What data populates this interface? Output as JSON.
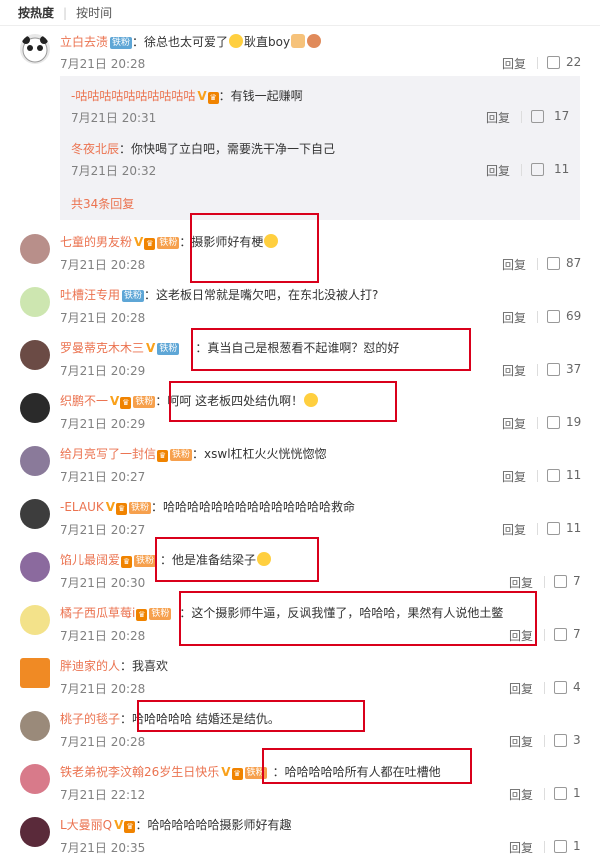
{
  "sort": {
    "hot": "按热度",
    "time": "按时间"
  },
  "reply_label": "回复",
  "more_replies": "共34条回复",
  "comments": [
    {
      "name": "立白去渍",
      "badge": "铁粉",
      "text": "：徐总也太可爱了",
      "text2": "耿直boy",
      "time": "7月21日 20:28",
      "likes": "22"
    },
    {
      "name": "七童的男友粉",
      "badge": "铁粉",
      "text": "：摄影师好有梗",
      "time": "7月21日 20:28",
      "likes": "87"
    },
    {
      "name": "吐槽汪专用",
      "badge": "铁粉",
      "text": "：这老板日常就是嘴欠吧，在东北没被人打?",
      "time": "7月21日 20:28",
      "likes": "69"
    },
    {
      "name": "罗曼蒂克木木三",
      "badge": "铁粉",
      "text": "：真当自己是根葱看不起谁啊？怼的好",
      "time": "7月21日 20:29",
      "likes": "37"
    },
    {
      "name": "织鹏不一",
      "badge": "铁粉",
      "text": "：呵呵 这老板四处结仇啊！",
      "time": "7月21日 20:29",
      "likes": "19"
    },
    {
      "name": "给月亮写了一封信",
      "badge": "铁粉",
      "text": "：xswl杠杠火火恍恍惚惚",
      "time": "7月21日 20:27",
      "likes": "11"
    },
    {
      "name": "-ELAUK",
      "badge": "铁粉",
      "text": "：哈哈哈哈哈哈哈哈哈哈哈哈哈哈救命",
      "time": "7月21日 20:27",
      "likes": "11"
    },
    {
      "name": "馅儿最阔爱",
      "badge": "铁粉",
      "text": "：他是准备结梁子",
      "time": "7月21日 20:30",
      "likes": "7"
    },
    {
      "name": "橘子西瓜草莓i",
      "badge": "铁粉",
      "text": "：这个摄影师牛逼，反讽我懂了，哈哈哈，果然有人说他土鳖",
      "time": "7月21日 20:28",
      "likes": "7"
    },
    {
      "name": "胖迪家的人",
      "badge": "",
      "text": "：我喜欢",
      "time": "7月21日 20:28",
      "likes": "4"
    },
    {
      "name": "桃子的毯子",
      "badge": "",
      "text": "：哈哈哈哈哈 结婚还是结仇。",
      "time": "7月21日 20:28",
      "likes": "3"
    },
    {
      "name": "铁老弟祝李汶翰26岁生日快乐",
      "badge": "铁粉",
      "text": "：哈哈哈哈哈所有人都在吐槽他",
      "time": "7月21日 22:12",
      "likes": "1"
    },
    {
      "name": "L大曼丽Q",
      "badge": "",
      "text": "：哈哈哈哈哈哈摄影师好有趣",
      "time": "7月21日 20:35",
      "likes": "1"
    }
  ],
  "subreplies": [
    {
      "name": "-咕咕咕咕咕咕咕咕咕咕",
      "text": "：有钱一起赚啊",
      "time": "7月21日 20:31",
      "likes": "17"
    },
    {
      "name": "冬夜北辰",
      "text": "：你快喝了立白吧，需要洗干净一下自己",
      "time": "7月21日 20:32",
      "likes": "11"
    }
  ],
  "colors": {
    "name": "#eb7350",
    "highlight_box": "#d9001b",
    "sub_bg": "#f2f2f5"
  }
}
